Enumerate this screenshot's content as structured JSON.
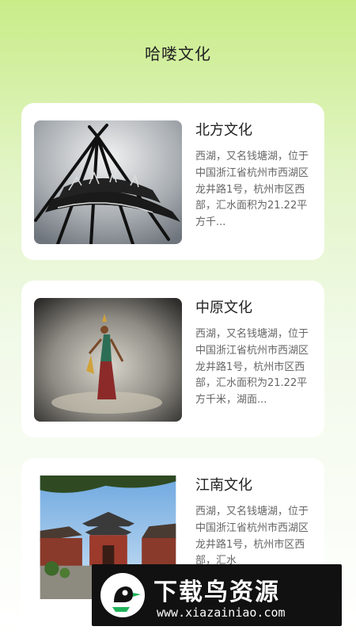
{
  "header": {
    "title": "哈喽文化"
  },
  "cards": [
    {
      "title": "北方文化",
      "description": "西湖，又名钱塘湖，位于中国浙江省杭州市西湖区龙井路1号，杭州市区西部，汇水面积为21.22平方千...",
      "image": "tipi-image"
    },
    {
      "title": "中原文化",
      "description": "西湖，又名钱塘湖，位于中国浙江省杭州市西湖区龙井路1号，杭州市区西部，汇水面积为21.22平方千米，湖面...",
      "image": "dancer-image"
    },
    {
      "title": "江南文化",
      "description": "西湖，又名钱塘湖，位于中国浙江省杭州市西湖区龙井路1号，杭州市区西部，汇水",
      "image": "temple-image"
    }
  ],
  "watermark": {
    "text": "下载鸟资源",
    "url": "www.xiazainiao.com"
  }
}
